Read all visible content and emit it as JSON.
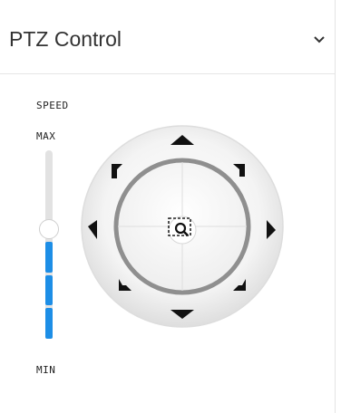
{
  "panel": {
    "title": "PTZ Control",
    "collapse_icon": "chevron-down-icon"
  },
  "speed": {
    "label": "SPEED",
    "max_label": "MAX",
    "min_label": "MIN",
    "level": 0.58
  },
  "joystick": {
    "center_icon": "zoom-area-icon",
    "directions": [
      "up",
      "down",
      "left",
      "right",
      "up-left",
      "up-right",
      "down-left",
      "down-right"
    ]
  },
  "colors": {
    "accent": "#1d8ee6",
    "arrow": "#111111",
    "ring": "#9a9a9a"
  }
}
